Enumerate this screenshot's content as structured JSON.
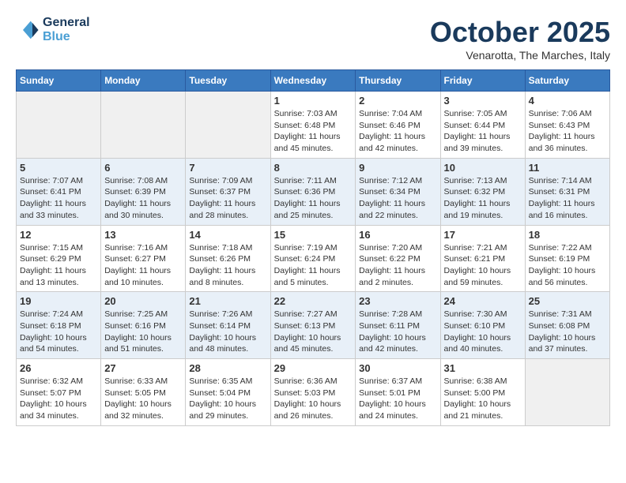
{
  "header": {
    "logo_line1": "General",
    "logo_line2": "Blue",
    "month": "October 2025",
    "location": "Venarotta, The Marches, Italy"
  },
  "weekdays": [
    "Sunday",
    "Monday",
    "Tuesday",
    "Wednesday",
    "Thursday",
    "Friday",
    "Saturday"
  ],
  "weeks": [
    [
      {
        "day": "",
        "sunrise": "",
        "sunset": "",
        "daylight": ""
      },
      {
        "day": "",
        "sunrise": "",
        "sunset": "",
        "daylight": ""
      },
      {
        "day": "",
        "sunrise": "",
        "sunset": "",
        "daylight": ""
      },
      {
        "day": "1",
        "sunrise": "Sunrise: 7:03 AM",
        "sunset": "Sunset: 6:48 PM",
        "daylight": "Daylight: 11 hours and 45 minutes."
      },
      {
        "day": "2",
        "sunrise": "Sunrise: 7:04 AM",
        "sunset": "Sunset: 6:46 PM",
        "daylight": "Daylight: 11 hours and 42 minutes."
      },
      {
        "day": "3",
        "sunrise": "Sunrise: 7:05 AM",
        "sunset": "Sunset: 6:44 PM",
        "daylight": "Daylight: 11 hours and 39 minutes."
      },
      {
        "day": "4",
        "sunrise": "Sunrise: 7:06 AM",
        "sunset": "Sunset: 6:43 PM",
        "daylight": "Daylight: 11 hours and 36 minutes."
      }
    ],
    [
      {
        "day": "5",
        "sunrise": "Sunrise: 7:07 AM",
        "sunset": "Sunset: 6:41 PM",
        "daylight": "Daylight: 11 hours and 33 minutes."
      },
      {
        "day": "6",
        "sunrise": "Sunrise: 7:08 AM",
        "sunset": "Sunset: 6:39 PM",
        "daylight": "Daylight: 11 hours and 30 minutes."
      },
      {
        "day": "7",
        "sunrise": "Sunrise: 7:09 AM",
        "sunset": "Sunset: 6:37 PM",
        "daylight": "Daylight: 11 hours and 28 minutes."
      },
      {
        "day": "8",
        "sunrise": "Sunrise: 7:11 AM",
        "sunset": "Sunset: 6:36 PM",
        "daylight": "Daylight: 11 hours and 25 minutes."
      },
      {
        "day": "9",
        "sunrise": "Sunrise: 7:12 AM",
        "sunset": "Sunset: 6:34 PM",
        "daylight": "Daylight: 11 hours and 22 minutes."
      },
      {
        "day": "10",
        "sunrise": "Sunrise: 7:13 AM",
        "sunset": "Sunset: 6:32 PM",
        "daylight": "Daylight: 11 hours and 19 minutes."
      },
      {
        "day": "11",
        "sunrise": "Sunrise: 7:14 AM",
        "sunset": "Sunset: 6:31 PM",
        "daylight": "Daylight: 11 hours and 16 minutes."
      }
    ],
    [
      {
        "day": "12",
        "sunrise": "Sunrise: 7:15 AM",
        "sunset": "Sunset: 6:29 PM",
        "daylight": "Daylight: 11 hours and 13 minutes."
      },
      {
        "day": "13",
        "sunrise": "Sunrise: 7:16 AM",
        "sunset": "Sunset: 6:27 PM",
        "daylight": "Daylight: 11 hours and 10 minutes."
      },
      {
        "day": "14",
        "sunrise": "Sunrise: 7:18 AM",
        "sunset": "Sunset: 6:26 PM",
        "daylight": "Daylight: 11 hours and 8 minutes."
      },
      {
        "day": "15",
        "sunrise": "Sunrise: 7:19 AM",
        "sunset": "Sunset: 6:24 PM",
        "daylight": "Daylight: 11 hours and 5 minutes."
      },
      {
        "day": "16",
        "sunrise": "Sunrise: 7:20 AM",
        "sunset": "Sunset: 6:22 PM",
        "daylight": "Daylight: 11 hours and 2 minutes."
      },
      {
        "day": "17",
        "sunrise": "Sunrise: 7:21 AM",
        "sunset": "Sunset: 6:21 PM",
        "daylight": "Daylight: 10 hours and 59 minutes."
      },
      {
        "day": "18",
        "sunrise": "Sunrise: 7:22 AM",
        "sunset": "Sunset: 6:19 PM",
        "daylight": "Daylight: 10 hours and 56 minutes."
      }
    ],
    [
      {
        "day": "19",
        "sunrise": "Sunrise: 7:24 AM",
        "sunset": "Sunset: 6:18 PM",
        "daylight": "Daylight: 10 hours and 54 minutes."
      },
      {
        "day": "20",
        "sunrise": "Sunrise: 7:25 AM",
        "sunset": "Sunset: 6:16 PM",
        "daylight": "Daylight: 10 hours and 51 minutes."
      },
      {
        "day": "21",
        "sunrise": "Sunrise: 7:26 AM",
        "sunset": "Sunset: 6:14 PM",
        "daylight": "Daylight: 10 hours and 48 minutes."
      },
      {
        "day": "22",
        "sunrise": "Sunrise: 7:27 AM",
        "sunset": "Sunset: 6:13 PM",
        "daylight": "Daylight: 10 hours and 45 minutes."
      },
      {
        "day": "23",
        "sunrise": "Sunrise: 7:28 AM",
        "sunset": "Sunset: 6:11 PM",
        "daylight": "Daylight: 10 hours and 42 minutes."
      },
      {
        "day": "24",
        "sunrise": "Sunrise: 7:30 AM",
        "sunset": "Sunset: 6:10 PM",
        "daylight": "Daylight: 10 hours and 40 minutes."
      },
      {
        "day": "25",
        "sunrise": "Sunrise: 7:31 AM",
        "sunset": "Sunset: 6:08 PM",
        "daylight": "Daylight: 10 hours and 37 minutes."
      }
    ],
    [
      {
        "day": "26",
        "sunrise": "Sunrise: 6:32 AM",
        "sunset": "Sunset: 5:07 PM",
        "daylight": "Daylight: 10 hours and 34 minutes."
      },
      {
        "day": "27",
        "sunrise": "Sunrise: 6:33 AM",
        "sunset": "Sunset: 5:05 PM",
        "daylight": "Daylight: 10 hours and 32 minutes."
      },
      {
        "day": "28",
        "sunrise": "Sunrise: 6:35 AM",
        "sunset": "Sunset: 5:04 PM",
        "daylight": "Daylight: 10 hours and 29 minutes."
      },
      {
        "day": "29",
        "sunrise": "Sunrise: 6:36 AM",
        "sunset": "Sunset: 5:03 PM",
        "daylight": "Daylight: 10 hours and 26 minutes."
      },
      {
        "day": "30",
        "sunrise": "Sunrise: 6:37 AM",
        "sunset": "Sunset: 5:01 PM",
        "daylight": "Daylight: 10 hours and 24 minutes."
      },
      {
        "day": "31",
        "sunrise": "Sunrise: 6:38 AM",
        "sunset": "Sunset: 5:00 PM",
        "daylight": "Daylight: 10 hours and 21 minutes."
      },
      {
        "day": "",
        "sunrise": "",
        "sunset": "",
        "daylight": ""
      }
    ]
  ]
}
